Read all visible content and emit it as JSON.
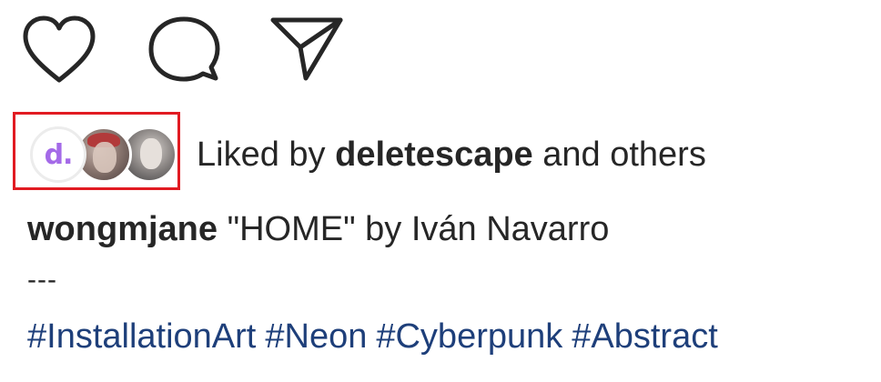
{
  "actions": {
    "like_icon": "heart-icon",
    "comment_icon": "comment-icon",
    "share_icon": "send-icon"
  },
  "likes": {
    "avatar_logo_text": "d.",
    "prefix": "Liked by",
    "user": "deletescape",
    "suffix": "and others"
  },
  "caption": {
    "username": "wongmjane",
    "text": "\"HOME\" by Iván Navarro",
    "divider": "---",
    "hashtags": [
      "#InstallationArt",
      "#Neon",
      "#Cyberpunk",
      "#Abstract"
    ]
  },
  "colors": {
    "highlight": "#e11b22",
    "hashtag": "#1e3f7a",
    "logo": "#a46ae8"
  }
}
